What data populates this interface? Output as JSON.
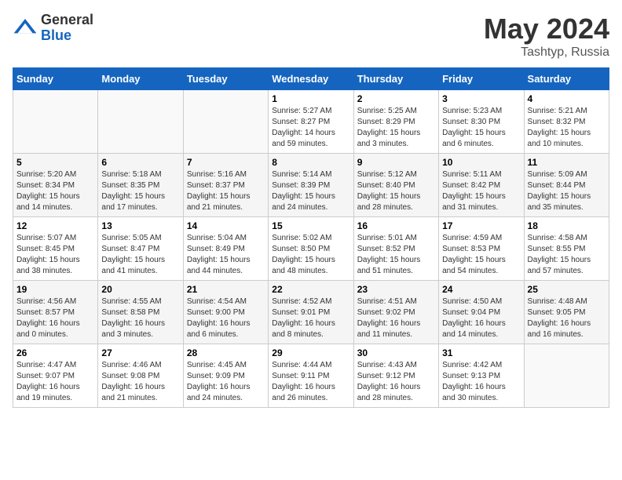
{
  "header": {
    "logo_general": "General",
    "logo_blue": "Blue",
    "title": "May 2024",
    "location": "Tashtyp, Russia"
  },
  "days_of_week": [
    "Sunday",
    "Monday",
    "Tuesday",
    "Wednesday",
    "Thursday",
    "Friday",
    "Saturday"
  ],
  "weeks": [
    [
      {
        "day": "",
        "sunrise": "",
        "sunset": "",
        "daylight": ""
      },
      {
        "day": "",
        "sunrise": "",
        "sunset": "",
        "daylight": ""
      },
      {
        "day": "",
        "sunrise": "",
        "sunset": "",
        "daylight": ""
      },
      {
        "day": "1",
        "sunrise": "Sunrise: 5:27 AM",
        "sunset": "Sunset: 8:27 PM",
        "daylight": "Daylight: 14 hours and 59 minutes."
      },
      {
        "day": "2",
        "sunrise": "Sunrise: 5:25 AM",
        "sunset": "Sunset: 8:29 PM",
        "daylight": "Daylight: 15 hours and 3 minutes."
      },
      {
        "day": "3",
        "sunrise": "Sunrise: 5:23 AM",
        "sunset": "Sunset: 8:30 PM",
        "daylight": "Daylight: 15 hours and 6 minutes."
      },
      {
        "day": "4",
        "sunrise": "Sunrise: 5:21 AM",
        "sunset": "Sunset: 8:32 PM",
        "daylight": "Daylight: 15 hours and 10 minutes."
      }
    ],
    [
      {
        "day": "5",
        "sunrise": "Sunrise: 5:20 AM",
        "sunset": "Sunset: 8:34 PM",
        "daylight": "Daylight: 15 hours and 14 minutes."
      },
      {
        "day": "6",
        "sunrise": "Sunrise: 5:18 AM",
        "sunset": "Sunset: 8:35 PM",
        "daylight": "Daylight: 15 hours and 17 minutes."
      },
      {
        "day": "7",
        "sunrise": "Sunrise: 5:16 AM",
        "sunset": "Sunset: 8:37 PM",
        "daylight": "Daylight: 15 hours and 21 minutes."
      },
      {
        "day": "8",
        "sunrise": "Sunrise: 5:14 AM",
        "sunset": "Sunset: 8:39 PM",
        "daylight": "Daylight: 15 hours and 24 minutes."
      },
      {
        "day": "9",
        "sunrise": "Sunrise: 5:12 AM",
        "sunset": "Sunset: 8:40 PM",
        "daylight": "Daylight: 15 hours and 28 minutes."
      },
      {
        "day": "10",
        "sunrise": "Sunrise: 5:11 AM",
        "sunset": "Sunset: 8:42 PM",
        "daylight": "Daylight: 15 hours and 31 minutes."
      },
      {
        "day": "11",
        "sunrise": "Sunrise: 5:09 AM",
        "sunset": "Sunset: 8:44 PM",
        "daylight": "Daylight: 15 hours and 35 minutes."
      }
    ],
    [
      {
        "day": "12",
        "sunrise": "Sunrise: 5:07 AM",
        "sunset": "Sunset: 8:45 PM",
        "daylight": "Daylight: 15 hours and 38 minutes."
      },
      {
        "day": "13",
        "sunrise": "Sunrise: 5:05 AM",
        "sunset": "Sunset: 8:47 PM",
        "daylight": "Daylight: 15 hours and 41 minutes."
      },
      {
        "day": "14",
        "sunrise": "Sunrise: 5:04 AM",
        "sunset": "Sunset: 8:49 PM",
        "daylight": "Daylight: 15 hours and 44 minutes."
      },
      {
        "day": "15",
        "sunrise": "Sunrise: 5:02 AM",
        "sunset": "Sunset: 8:50 PM",
        "daylight": "Daylight: 15 hours and 48 minutes."
      },
      {
        "day": "16",
        "sunrise": "Sunrise: 5:01 AM",
        "sunset": "Sunset: 8:52 PM",
        "daylight": "Daylight: 15 hours and 51 minutes."
      },
      {
        "day": "17",
        "sunrise": "Sunrise: 4:59 AM",
        "sunset": "Sunset: 8:53 PM",
        "daylight": "Daylight: 15 hours and 54 minutes."
      },
      {
        "day": "18",
        "sunrise": "Sunrise: 4:58 AM",
        "sunset": "Sunset: 8:55 PM",
        "daylight": "Daylight: 15 hours and 57 minutes."
      }
    ],
    [
      {
        "day": "19",
        "sunrise": "Sunrise: 4:56 AM",
        "sunset": "Sunset: 8:57 PM",
        "daylight": "Daylight: 16 hours and 0 minutes."
      },
      {
        "day": "20",
        "sunrise": "Sunrise: 4:55 AM",
        "sunset": "Sunset: 8:58 PM",
        "daylight": "Daylight: 16 hours and 3 minutes."
      },
      {
        "day": "21",
        "sunrise": "Sunrise: 4:54 AM",
        "sunset": "Sunset: 9:00 PM",
        "daylight": "Daylight: 16 hours and 6 minutes."
      },
      {
        "day": "22",
        "sunrise": "Sunrise: 4:52 AM",
        "sunset": "Sunset: 9:01 PM",
        "daylight": "Daylight: 16 hours and 8 minutes."
      },
      {
        "day": "23",
        "sunrise": "Sunrise: 4:51 AM",
        "sunset": "Sunset: 9:02 PM",
        "daylight": "Daylight: 16 hours and 11 minutes."
      },
      {
        "day": "24",
        "sunrise": "Sunrise: 4:50 AM",
        "sunset": "Sunset: 9:04 PM",
        "daylight": "Daylight: 16 hours and 14 minutes."
      },
      {
        "day": "25",
        "sunrise": "Sunrise: 4:48 AM",
        "sunset": "Sunset: 9:05 PM",
        "daylight": "Daylight: 16 hours and 16 minutes."
      }
    ],
    [
      {
        "day": "26",
        "sunrise": "Sunrise: 4:47 AM",
        "sunset": "Sunset: 9:07 PM",
        "daylight": "Daylight: 16 hours and 19 minutes."
      },
      {
        "day": "27",
        "sunrise": "Sunrise: 4:46 AM",
        "sunset": "Sunset: 9:08 PM",
        "daylight": "Daylight: 16 hours and 21 minutes."
      },
      {
        "day": "28",
        "sunrise": "Sunrise: 4:45 AM",
        "sunset": "Sunset: 9:09 PM",
        "daylight": "Daylight: 16 hours and 24 minutes."
      },
      {
        "day": "29",
        "sunrise": "Sunrise: 4:44 AM",
        "sunset": "Sunset: 9:11 PM",
        "daylight": "Daylight: 16 hours and 26 minutes."
      },
      {
        "day": "30",
        "sunrise": "Sunrise: 4:43 AM",
        "sunset": "Sunset: 9:12 PM",
        "daylight": "Daylight: 16 hours and 28 minutes."
      },
      {
        "day": "31",
        "sunrise": "Sunrise: 4:42 AM",
        "sunset": "Sunset: 9:13 PM",
        "daylight": "Daylight: 16 hours and 30 minutes."
      },
      {
        "day": "",
        "sunrise": "",
        "sunset": "",
        "daylight": ""
      }
    ]
  ]
}
